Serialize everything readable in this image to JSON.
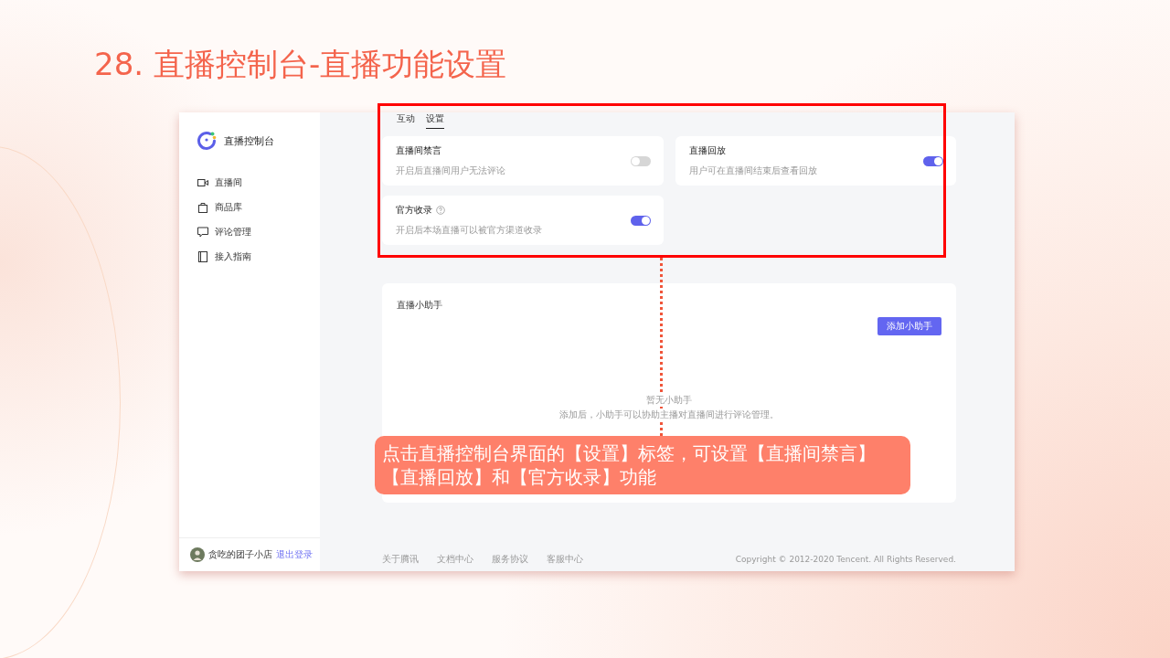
{
  "slide_title": "28. 直播控制台-直播功能设置",
  "sidebar": {
    "logo_text": "直播控制台",
    "items": [
      {
        "label": "直播间"
      },
      {
        "label": "商品库"
      },
      {
        "label": "评论管理"
      },
      {
        "label": "接入指南"
      }
    ],
    "user": {
      "name": "贪吃的团子小店",
      "logout": "退出登录"
    }
  },
  "tabs": [
    {
      "label": "互动",
      "selected": false
    },
    {
      "label": "设置",
      "selected": true
    }
  ],
  "settings": [
    {
      "title": "直播间禁言",
      "description": "开启后直播间用户无法评论",
      "on": false,
      "help": false
    },
    {
      "title": "直播回放",
      "description": "用户可在直播间结束后查看回放",
      "on": true,
      "help": false
    },
    {
      "title": "官方收录",
      "description": "开启后本场直播可以被官方渠道收录",
      "on": true,
      "help": true
    }
  ],
  "assistant": {
    "title": "直播小助手",
    "button": "添加小助手",
    "empty_title": "暂无小助手",
    "empty_hint": "添加后，小助手可以协助主播对直播间进行评论管理。"
  },
  "footer": {
    "links": [
      "关于腾讯",
      "文档中心",
      "服务协议",
      "客服中心"
    ],
    "copyright": "Copyright © 2012-2020 Tencent. All Rights Reserved."
  },
  "annotation": {
    "text": "点击直播控制台界面的【设置】标签，可设置【直播间禁言】【直播回放】和【官方收录】功能"
  }
}
